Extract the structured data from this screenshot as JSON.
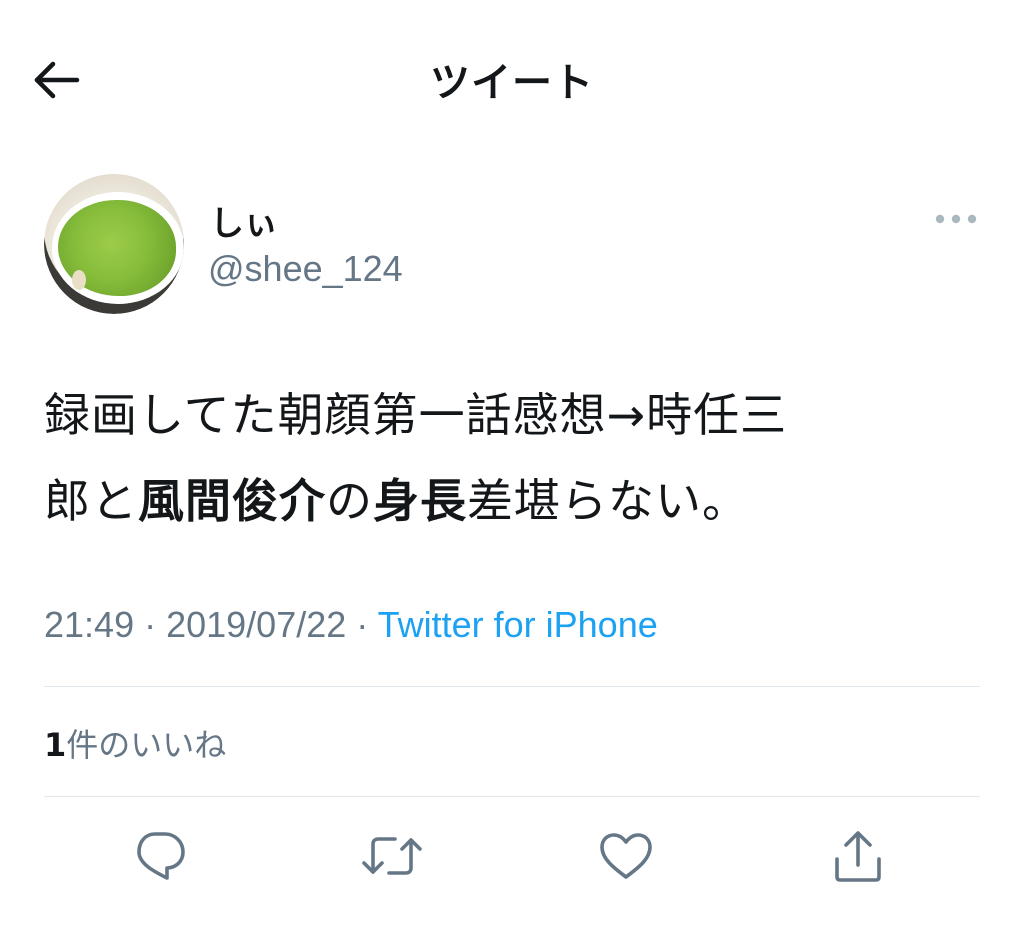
{
  "header": {
    "title": "ツイート"
  },
  "tweet": {
    "user": {
      "name": "しぃ",
      "handle": "@shee_124"
    },
    "text": {
      "line1": "録画してた朝顔第一話感想→時任三",
      "line2_a": "郎と",
      "line2_b": "風間俊介",
      "line2_c": "の",
      "line2_d": "身長",
      "line2_e": "差堪らない。"
    },
    "meta": {
      "time": "21:49",
      "separator1": " · ",
      "date": "2019/07/22",
      "separator2": " · ",
      "source": "Twitter for iPhone"
    },
    "likes": {
      "count": "1",
      "label": "件のいいね"
    }
  },
  "icons": {
    "back": "arrow-left-icon",
    "more": "more-dots-icon",
    "reply": "reply-icon",
    "retweet": "retweet-icon",
    "like": "heart-icon",
    "share": "share-icon"
  },
  "colors": {
    "text": "#14171a",
    "secondary": "#657786",
    "link": "#1da1f2",
    "divider": "#e1e8ed"
  }
}
